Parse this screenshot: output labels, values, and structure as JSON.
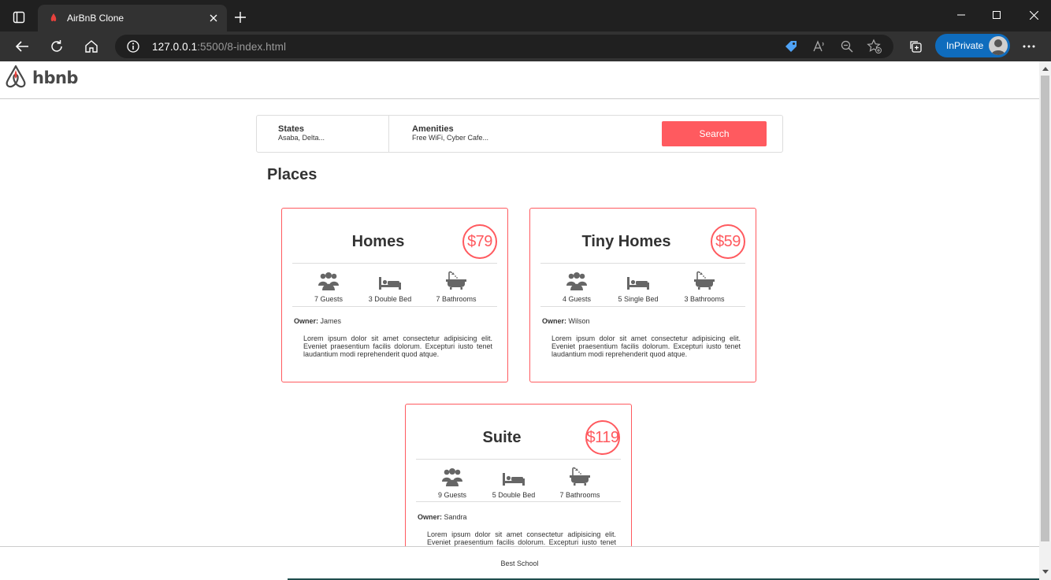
{
  "browser": {
    "tab": {
      "title": "AirBnB Clone"
    },
    "address": {
      "host": "127.0.0.1",
      "rest": ":5500/8-index.html"
    },
    "profile_label": "InPrivate"
  },
  "header": {
    "logo_text": "hbnb"
  },
  "filters": {
    "states": {
      "title": "States",
      "value": "Asaba, Delta..."
    },
    "amenities": {
      "title": "Amenities",
      "value": "Free WiFi, Cyber Cafe..."
    },
    "search_label": "Search"
  },
  "places": {
    "title": "Places",
    "owner_label": "Owner:",
    "items": [
      {
        "name": "Homes",
        "price": "$79",
        "guests": "7 Guests",
        "beds": "3 Double Bed",
        "baths": "7 Bathrooms",
        "owner": "James",
        "description": "Lorem ipsum dolor sit amet consectetur adipisicing elit. Eveniet praesentium facilis dolorum. Excepturi iusto tenet laudantium modi reprehenderit quod atque."
      },
      {
        "name": "Tiny Homes",
        "price": "$59",
        "guests": "4 Guests",
        "beds": "5 Single Bed",
        "baths": "3 Bathrooms",
        "owner": "Wilson",
        "description": "Lorem ipsum dolor sit amet consectetur adipisicing elit. Eveniet praesentium facilis dolorum. Excepturi iusto tenet laudantium modi reprehenderit quod atque."
      },
      {
        "name": "Suite",
        "price": "$119",
        "guests": "9 Guests",
        "beds": "5 Double Bed",
        "baths": "7 Bathrooms",
        "owner": "Sandra",
        "description": "Lorem ipsum dolor sit amet consectetur adipisicing elit. Eveniet praesentium facilis dolorum. Excepturi iusto tenet laudantium modi reprehenderit quod atque."
      }
    ]
  },
  "footer": {
    "text": "Best School"
  },
  "colors": {
    "accent": "#ff5a5f",
    "browser_blue": "#0f6cbd"
  }
}
